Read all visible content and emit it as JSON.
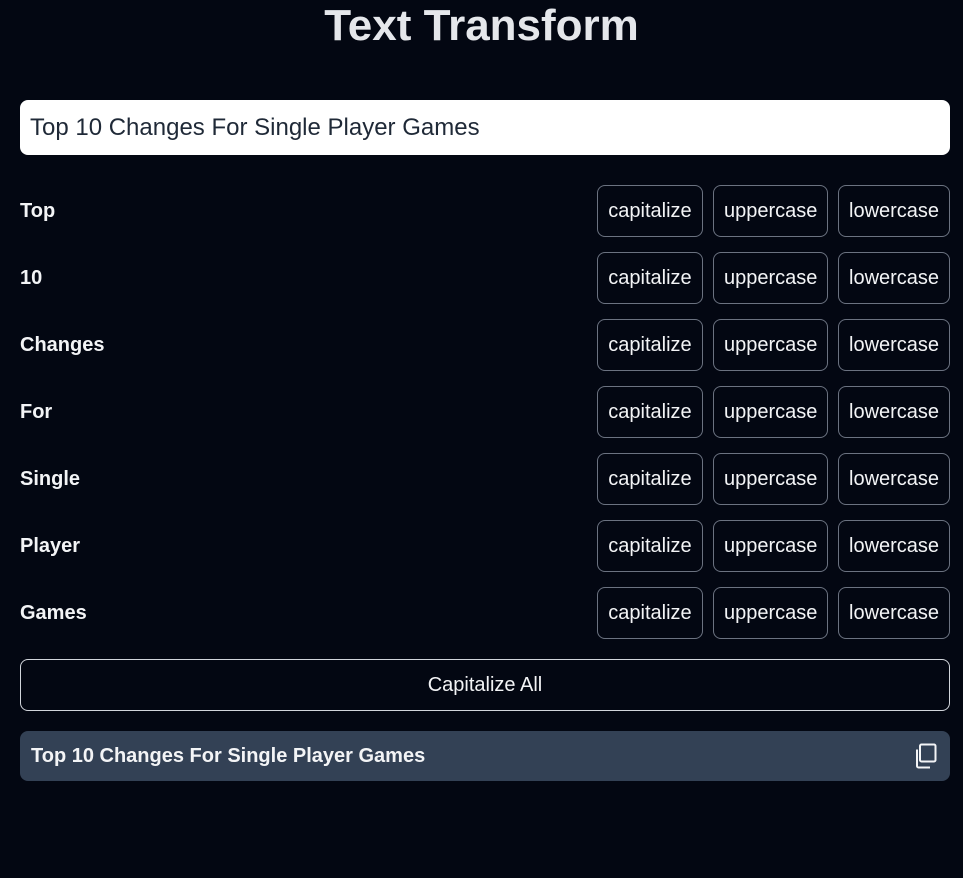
{
  "app": {
    "title": "Text Transform"
  },
  "input": {
    "value": "Top 10 Changes For Single Player Games"
  },
  "words": [
    {
      "word": "Top",
      "capitalize": "capitalize",
      "uppercase": "uppercase",
      "lowercase": "lowercase"
    },
    {
      "word": "10",
      "capitalize": "capitalize",
      "uppercase": "uppercase",
      "lowercase": "lowercase"
    },
    {
      "word": "Changes",
      "capitalize": "capitalize",
      "uppercase": "uppercase",
      "lowercase": "lowercase"
    },
    {
      "word": "For",
      "capitalize": "capitalize",
      "uppercase": "uppercase",
      "lowercase": "lowercase"
    },
    {
      "word": "Single",
      "capitalize": "capitalize",
      "uppercase": "uppercase",
      "lowercase": "lowercase"
    },
    {
      "word": "Player",
      "capitalize": "capitalize",
      "uppercase": "uppercase",
      "lowercase": "lowercase"
    },
    {
      "word": "Games",
      "capitalize": "capitalize",
      "uppercase": "uppercase",
      "lowercase": "lowercase"
    }
  ],
  "actions": {
    "capitalize_all_label": "Capitalize All"
  },
  "result": {
    "text": "Top 10 Changes For Single Player Games",
    "copy_icon": "copy-icon"
  },
  "colors": {
    "background": "#030712",
    "input_background": "#ffffff",
    "result_background": "#334155",
    "button_border": "#6b7280"
  }
}
